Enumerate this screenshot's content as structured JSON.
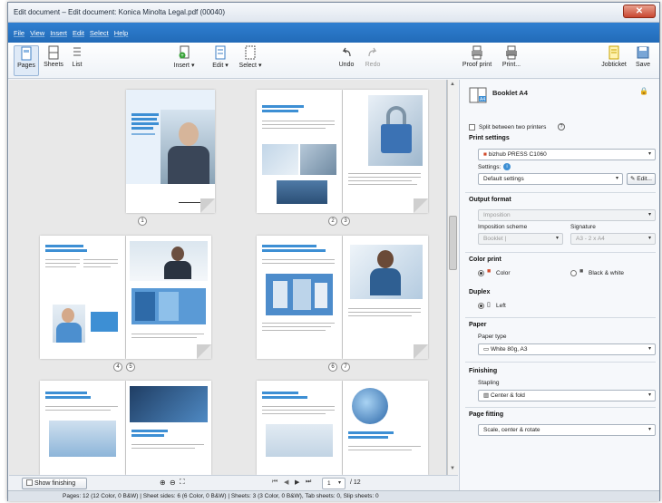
{
  "window": {
    "title": "Edit document – Edit document: Konica Minolta Legal.pdf (00040)",
    "close_glyph": "✕"
  },
  "menu": [
    "File",
    "View",
    "Insert",
    "Edit",
    "Select",
    "Help"
  ],
  "toolbar": {
    "view_pages": "Pages",
    "view_sheets": "Sheets",
    "view_list": "List",
    "insert": "Insert",
    "edit": "Edit",
    "select": "Select",
    "undo": "Undo",
    "redo": "Redo",
    "proof_print": "Proof print",
    "print": "Print...",
    "jobticket": "Jobticket",
    "save": "Save"
  },
  "pages": {
    "n1": "1",
    "n2": "2",
    "n3": "3",
    "n4": "4",
    "n5": "5",
    "n6": "6",
    "n7": "7"
  },
  "bottom": {
    "show_finishing": "Show finishing",
    "page_current": "1",
    "page_total": "/ 12"
  },
  "status": "Pages: 12 (12 Color, 0 B&W) | Sheet sides: 6 (6 Color, 0 B&W) | Sheets: 3 (3 Color, 0 B&W), Tab sheets: 0, Slip sheets: 0",
  "panel": {
    "product": "Booklet A4",
    "split_printers": "Split between two printers",
    "print_settings": "Print settings",
    "printer": "bizhub PRESS C1060",
    "settings_label": "Settings:",
    "settings_value": "Default settings",
    "edit_button": "Edit...",
    "output_format": "Output format",
    "imposition": "Imposition",
    "imposition_scheme_label": "Imposition scheme",
    "imposition_scheme_value": "Booklet |",
    "signature_label": "Signature",
    "signature_value": "A3 - 2 x A4",
    "color_print": "Color print",
    "color": "Color",
    "black_white": "Black & white",
    "duplex": "Duplex",
    "duplex_left": "Left",
    "paper": "Paper",
    "paper_type_label": "Paper type",
    "paper_type_value": "White 80g, A3",
    "finishing": "Finishing",
    "stapling_label": "Stapling",
    "stapling_value": "Center & fold",
    "page_fitting": "Page fitting",
    "page_fitting_value": "Scale, center & rotate"
  },
  "colors": {
    "menubar": "#2f7fd1",
    "accent_blue": "#3d8fd4",
    "close": "#c84630"
  }
}
